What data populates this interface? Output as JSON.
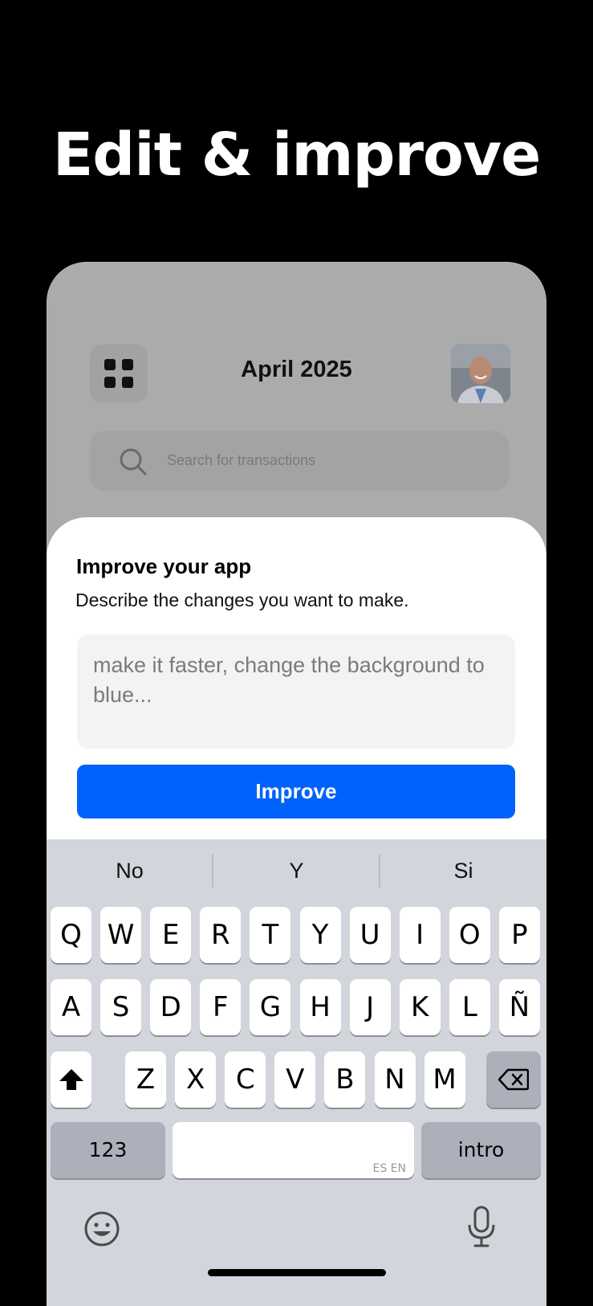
{
  "headline": "Edit & improve",
  "app": {
    "month_title": "April 2025",
    "search_placeholder": "Search for transactions"
  },
  "sheet": {
    "title": "Improve your app",
    "subtitle": "Describe the changes you want to make.",
    "input_placeholder": "make it faster, change the background to blue...",
    "improve_label": "Improve",
    "button_color": "#0162fb"
  },
  "keyboard": {
    "suggestions": [
      "No",
      "Y",
      "Si"
    ],
    "row1": [
      "Q",
      "W",
      "E",
      "R",
      "T",
      "Y",
      "U",
      "I",
      "O",
      "P"
    ],
    "row2": [
      "A",
      "S",
      "D",
      "F",
      "G",
      "H",
      "J",
      "K",
      "L",
      "Ñ"
    ],
    "row3": [
      "Z",
      "X",
      "C",
      "V",
      "B",
      "N",
      "M"
    ],
    "numbers_label": "123",
    "return_label": "intro",
    "space_lang": "ES EN",
    "icons": {
      "shift": "shift-icon",
      "delete": "backspace-icon",
      "emoji": "emoji-icon",
      "mic": "microphone-icon"
    }
  }
}
